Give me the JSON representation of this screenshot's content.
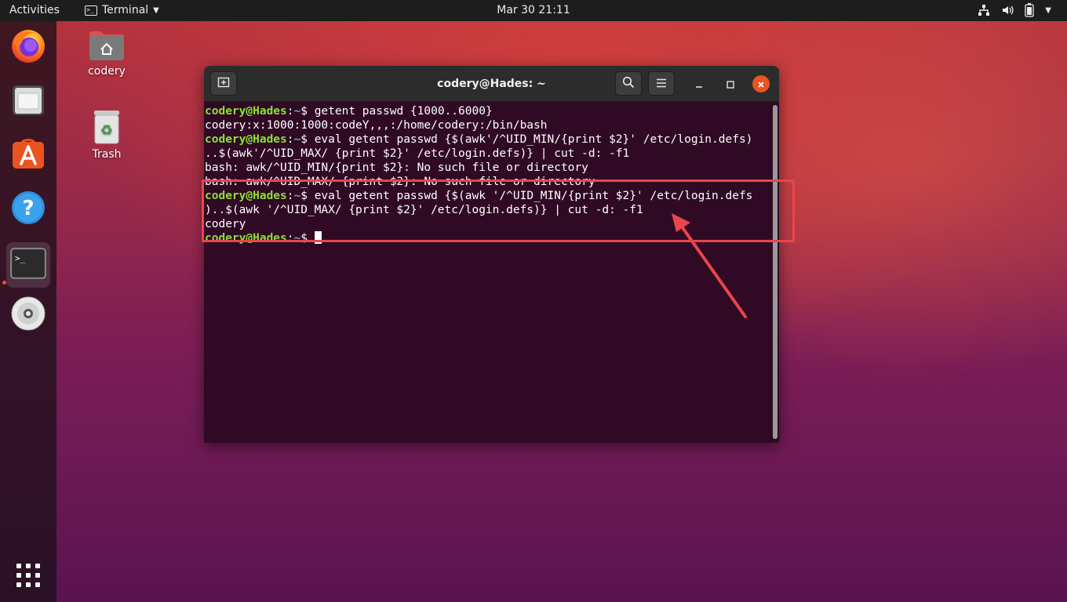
{
  "topbar": {
    "activities": "Activities",
    "app_name": "Terminal",
    "clock": "Mar 30  21:11"
  },
  "desktop": {
    "home_label": "codery",
    "trash_label": "Trash"
  },
  "terminal": {
    "title": "codery@Hades: ~",
    "prompt_user": "codery@Hades",
    "prompt_sep": ":",
    "prompt_path": "~",
    "prompt_dollar": "$ ",
    "lines": [
      {
        "type": "cmd",
        "text": "getent passwd {1000..6000}"
      },
      {
        "type": "out",
        "text": "codery:x:1000:1000:codeY,,,:/home/codery:/bin/bash"
      },
      {
        "type": "cmd",
        "text": "eval getent passwd {$(awk'/^UID_MIN/{print $2}' /etc/login.defs)"
      },
      {
        "type": "out",
        "text": "..$(awk'/^UID_MAX/ {print $2}' /etc/login.defs)} | cut -d: -f1"
      },
      {
        "type": "out",
        "text": "bash: awk/^UID_MIN/{print $2}: No such file or directory"
      },
      {
        "type": "out",
        "text": "bash: awk/^UID_MAX/ {print $2}: No such file or directory"
      },
      {
        "type": "cmd",
        "text": "eval getent passwd {$(awk '/^UID_MIN/{print $2}' /etc/login.defs"
      },
      {
        "type": "out",
        "text": ")..$(awk '/^UID_MAX/ {print $2}' /etc/login.defs)} | cut -d: -f1"
      },
      {
        "type": "out",
        "text": "codery"
      },
      {
        "type": "cmd",
        "text": ""
      }
    ]
  },
  "colors": {
    "prompt_user": "#8ae234",
    "prompt_path": "#729fcf",
    "terminal_bg": "#300a24",
    "highlight": "#e8464c"
  }
}
